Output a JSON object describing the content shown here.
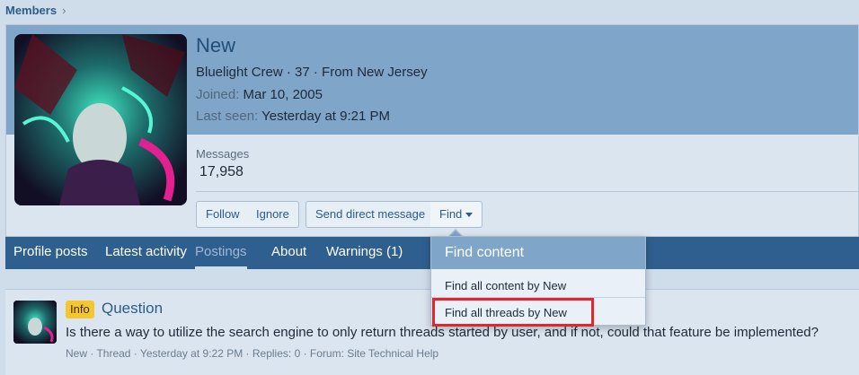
{
  "breadcrumb": {
    "label": "Members",
    "chevron": "›"
  },
  "profile": {
    "username": "New",
    "subtitle": "Bluelight Crew · 37 · From New Jersey",
    "joined_label": "Joined:",
    "joined_value": "Mar 10, 2005",
    "last_seen_label": "Last seen:",
    "last_seen_value": "Yesterday at 9:21 PM",
    "messages_label": "Messages",
    "messages_value": "17,958"
  },
  "actions": {
    "follow": "Follow",
    "ignore": "Ignore",
    "send_dm": "Send direct message",
    "find": "Find"
  },
  "tabs": [
    {
      "label": "Profile posts"
    },
    {
      "label": "Latest activity"
    },
    {
      "label": "Postings"
    },
    {
      "label": "About"
    },
    {
      "label": "Warnings (1)"
    }
  ],
  "dropdown": {
    "header": "Find content",
    "items": [
      "Find all content by New",
      "Find all threads by New"
    ]
  },
  "post": {
    "badge": "Info",
    "title": "Question",
    "snippet": "Is there a way to utilize the search engine to only return threads started by user, and if not, could that feature be implemented?",
    "meta": "New · Thread · Yesterday at 9:22 PM · Replies: 0 · Forum: Site Technical Help"
  },
  "colors": {
    "accent": "#2f5f8e",
    "header_band": "#7fa5c8",
    "highlight": "#e3262b",
    "badge": "#f7c62f"
  }
}
